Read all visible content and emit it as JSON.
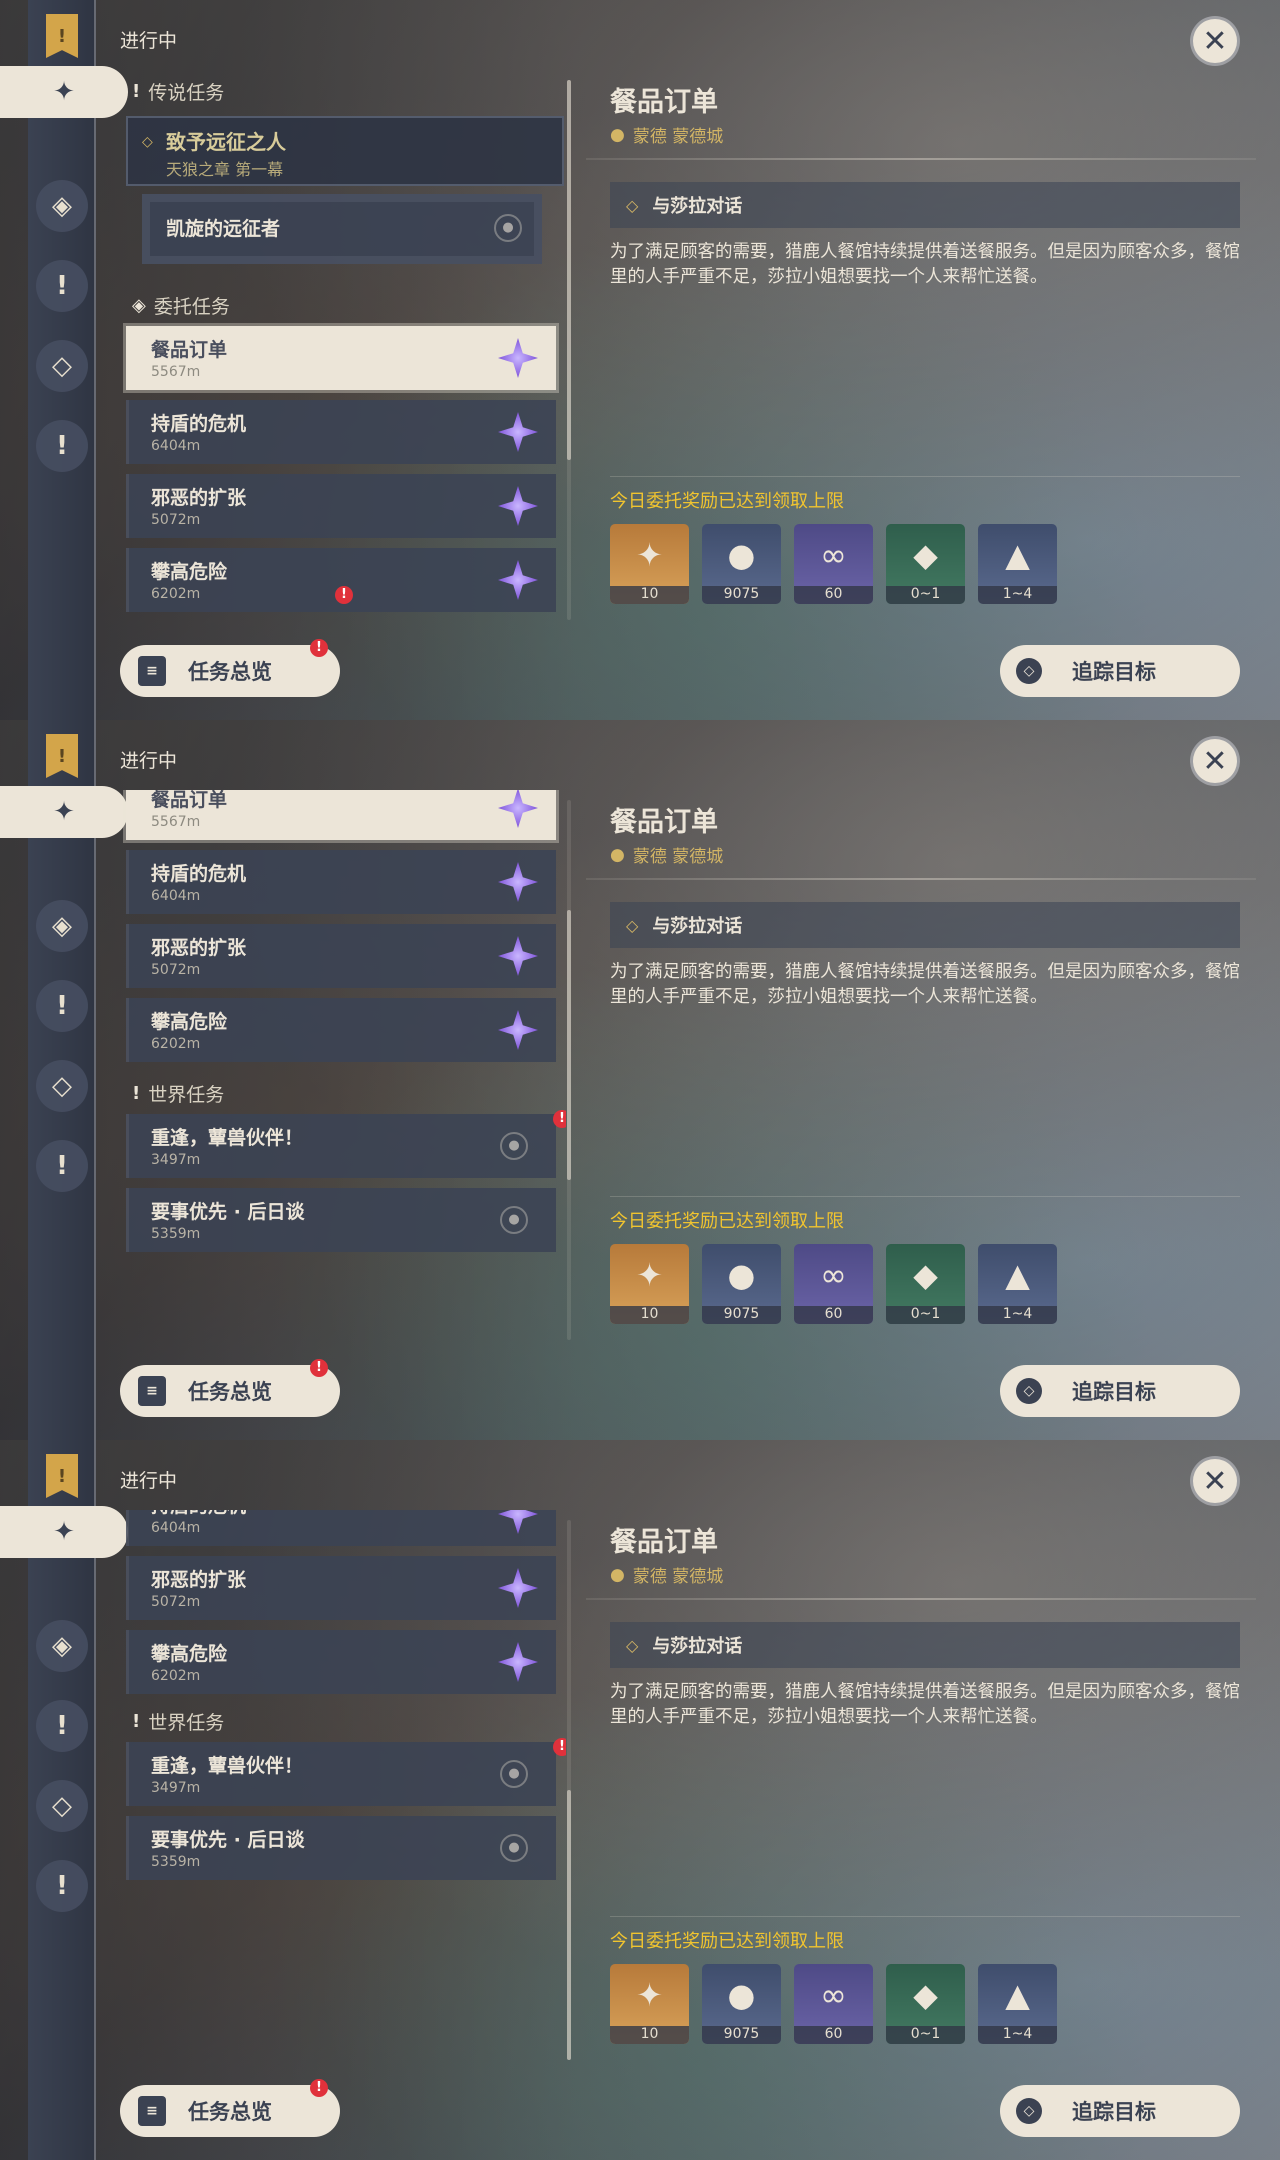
{
  "header": {
    "in_progress": "进行中"
  },
  "close_symbol": "✕",
  "categories": {
    "legend": "传说任务",
    "commission": "委托任务",
    "world": "世界任务"
  },
  "legend_quest": {
    "title": "致予远征之人",
    "chapter": "天狼之章 第一幕",
    "sub_title": "凯旋的远征者"
  },
  "commissions": [
    {
      "title": "餐品订单",
      "distance": "5567m"
    },
    {
      "title": "持盾的危机",
      "distance": "6404m"
    },
    {
      "title": "邪恶的扩张",
      "distance": "5072m"
    },
    {
      "title": "攀高危险",
      "distance": "6202m"
    }
  ],
  "world_quests": [
    {
      "title": "重逢，蕈兽伙伴！",
      "distance": "3497m"
    },
    {
      "title": "要事优先 · 后日谈",
      "distance": "5359m"
    }
  ],
  "buttons": {
    "overview": "任务总览",
    "track": "追踪目标"
  },
  "detail": {
    "title": "餐品订单",
    "location": "蒙德 蒙德城",
    "objective": "与莎拉对话",
    "description": "为了满足顾客的需要，猎鹿人餐馆持续提供着送餐服务。但是因为顾客众多，餐馆里的人手严重不足，莎拉小姐想要找一个人来帮忙送餐。",
    "reward_note": "今日委托奖励已达到领取上限",
    "rewards": [
      {
        "qty": "10",
        "icon": "primogem-icon",
        "color": "orange"
      },
      {
        "qty": "9075",
        "icon": "mora-icon",
        "color": "blue"
      },
      {
        "qty": "60",
        "icon": "companionship-exp-icon",
        "color": "purple"
      },
      {
        "qty": "0~1",
        "icon": "crystal-chunk-icon",
        "color": "green"
      },
      {
        "qty": "1~4",
        "icon": "crystal-cluster-icon",
        "color": "blue"
      }
    ]
  },
  "badge_mark": "!",
  "colors": {
    "cream": "#ece5d8",
    "slate": "#3b4252",
    "gold": "#d3b565",
    "yellow": "#f1c42f",
    "badge": "#e0313b"
  }
}
